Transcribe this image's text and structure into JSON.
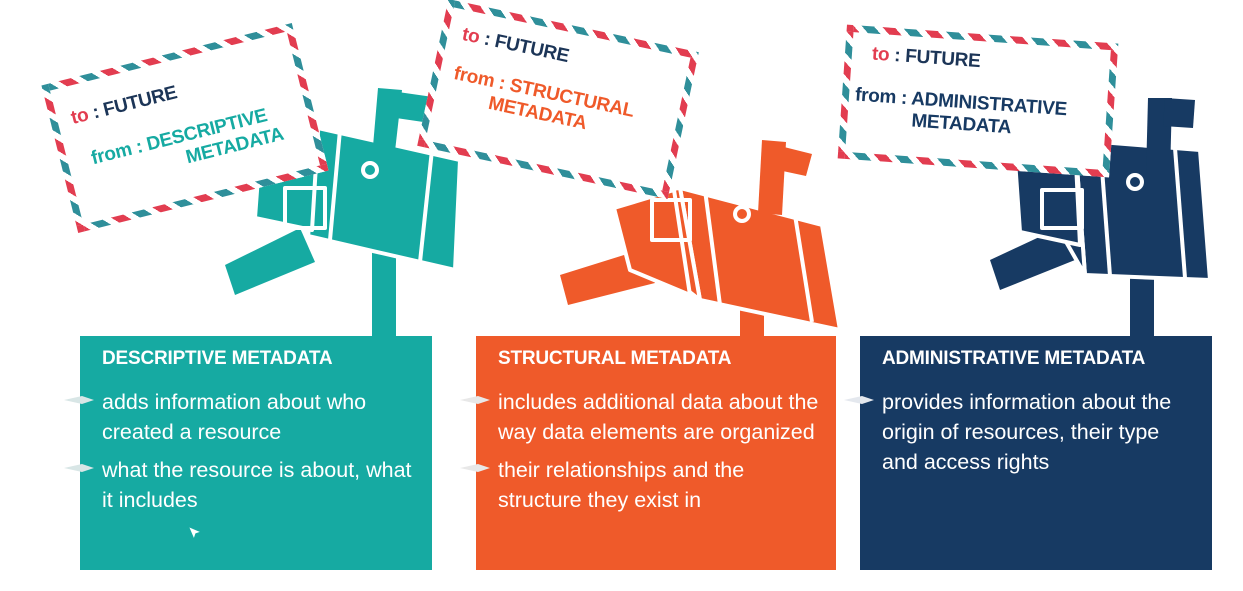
{
  "colors": {
    "descriptive": "#16aaa2",
    "structural": "#ef5a2a",
    "administrative": "#173a63",
    "stamp_red": "#e23d50",
    "stamp_teal": "#2f8f9a"
  },
  "envelopes": [
    {
      "to_label": "to",
      "to_value": ": FUTURE",
      "from_label": "from",
      "from_value_line1": ": DESCRIPTIVE",
      "from_value_line2": "METADATA"
    },
    {
      "to_label": "to",
      "to_value": ": FUTURE",
      "from_label": "from",
      "from_value_line1": ": STRUCTURAL",
      "from_value_line2": "METADATA"
    },
    {
      "to_label": "to",
      "to_value": ": FUTURE",
      "from_label": "from",
      "from_value_line1": ": ADMINISTRATIVE",
      "from_value_line2": "METADATA"
    }
  ],
  "panels": [
    {
      "title": "DESCRIPTIVE METADATA",
      "items": [
        "adds information about who created  a resource",
        "what the resource is about, what it includes"
      ]
    },
    {
      "title": "STRUCTURAL METADATA",
      "items": [
        "includes additional data about the way data elements are organized",
        "their relationships and the structure they exist in"
      ]
    },
    {
      "title": "ADMINISTRATIVE  METADATA",
      "items": [
        "provides information about the origin of resources, their type and access rights"
      ]
    }
  ],
  "icons": [
    "mailbox-icon",
    "flag-icon",
    "bullet-arrow-icon",
    "cursor-icon"
  ]
}
